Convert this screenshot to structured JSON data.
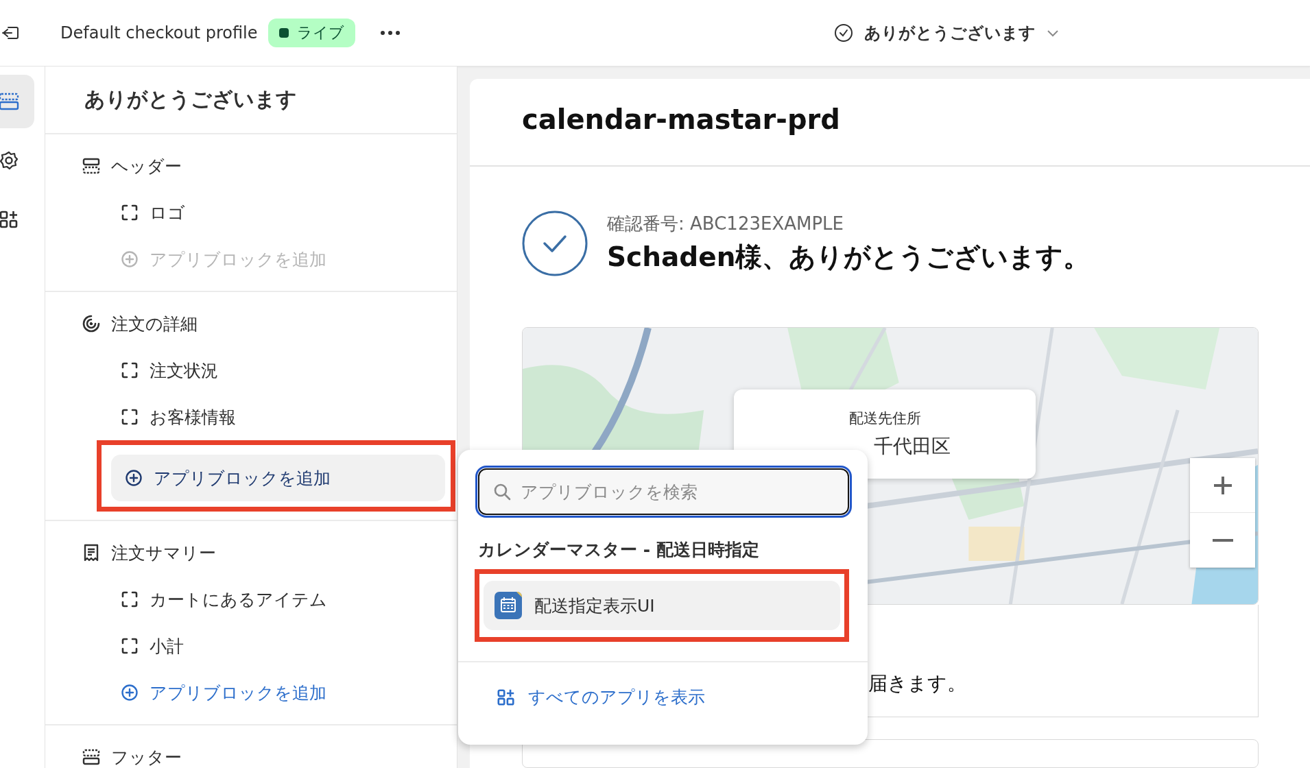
{
  "topbar": {
    "title": "Default checkout profile",
    "status_badge": "ライブ",
    "page_selector": "ありがとうございます"
  },
  "rail": [
    {
      "kind": "sections",
      "selected": true
    },
    {
      "kind": "settings",
      "selected": false
    },
    {
      "kind": "apps",
      "selected": false
    }
  ],
  "sidebar": {
    "title": "ありがとうございます",
    "sections": [
      {
        "kind": "header",
        "label": "ヘッダー",
        "children": [
          {
            "kind": "block",
            "label": "ロゴ"
          },
          {
            "kind": "add",
            "label": "アプリブロックを追加",
            "disabled": true,
            "selected": false,
            "highlighted": false
          }
        ]
      },
      {
        "kind": "details",
        "label": "注文の詳細",
        "children": [
          {
            "kind": "block",
            "label": "注文状況"
          },
          {
            "kind": "block",
            "label": "お客様情報"
          },
          {
            "kind": "add",
            "label": "アプリブロックを追加",
            "disabled": false,
            "selected": true,
            "highlighted": true
          }
        ]
      },
      {
        "kind": "summary",
        "label": "注文サマリー",
        "children": [
          {
            "kind": "block",
            "label": "カートにあるアイテム"
          },
          {
            "kind": "block",
            "label": "小計"
          },
          {
            "kind": "add",
            "label": "アプリブロックを追加",
            "disabled": false,
            "selected": false,
            "highlighted": false
          }
        ]
      },
      {
        "kind": "footer",
        "label": "フッター"
      }
    ]
  },
  "preview": {
    "shop_name": "calendar-mastar-prd",
    "confirmation": "確認番号: ABC123EXAMPLE",
    "greeting": "Schaden様、ありがとうございます。",
    "map": {
      "kind": "picture",
      "address_label": "配送先住所",
      "address": "千代田区"
    },
    "notice": "届きます。"
  },
  "popup": {
    "search_placeholder": "アプリブロックを検索",
    "group_title": "カレンダーマスター - 配送日時指定",
    "items": [
      {
        "label": "配送指定表示UI",
        "highlighted": true
      }
    ],
    "footer_link": "すべてのアプリを表示"
  }
}
